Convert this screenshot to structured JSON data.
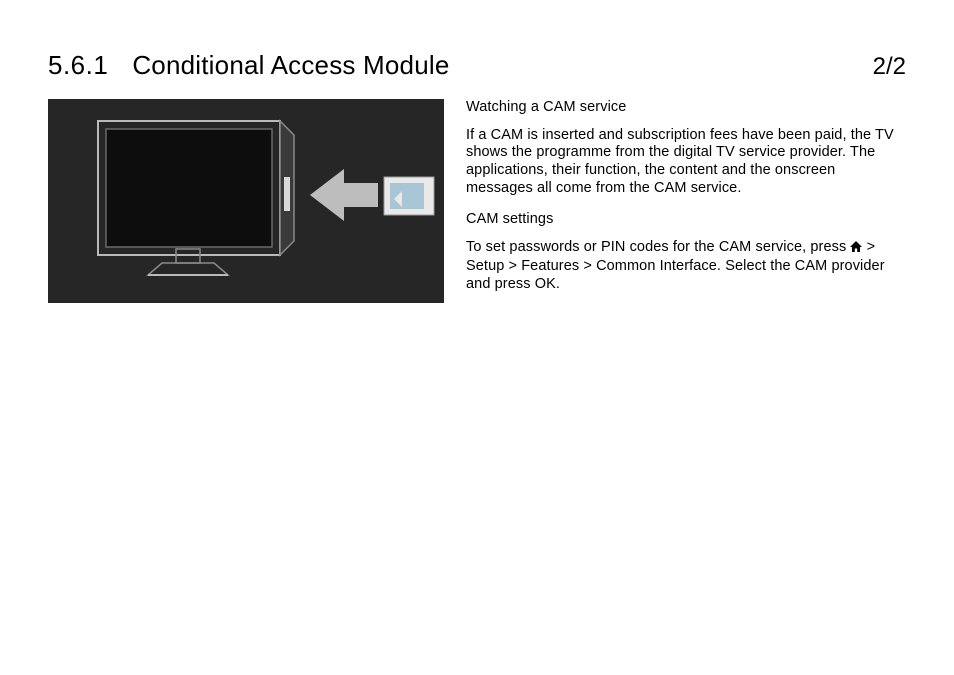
{
  "header": {
    "section_number": "5.6.1",
    "title": "Conditional Access Module",
    "page_counter": "2/2"
  },
  "body": {
    "subhead1": "Watching a CAM service",
    "para1": "If a CAM is inserted and subscription fees have been paid, the TV shows the programme from the digital TV service provider. The applications, their function, the content and the onscreen messages all come from the CAM service.",
    "subhead2": "CAM settings",
    "para2_pre": "To set passwords or PIN codes for the CAM service, press ",
    "para2_post": " > Setup > Features > Common Interface. Select the CAM provider and press OK."
  },
  "icons": {
    "home": "home-icon"
  }
}
